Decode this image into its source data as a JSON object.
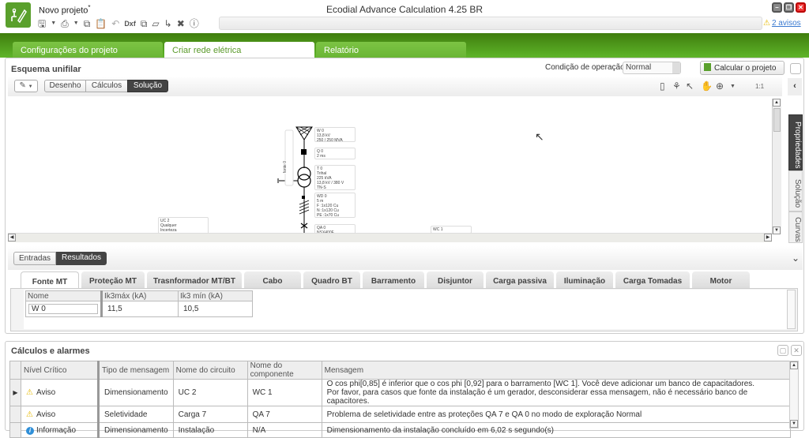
{
  "app": {
    "project_name": "Novo projeto",
    "unsaved_marker": "*",
    "window_title": "Ecodial Advance Calculation 4.25 BR",
    "warnings_link": "2 avisos",
    "quick_access": [
      "save-icon",
      "dropdown",
      "print-icon",
      "dropdown",
      "copy-icon",
      "paste-icon",
      "undo-icon",
      "Dxf",
      "attach-icon",
      "shape-icon",
      "export-icon",
      "tools-icon",
      "help-icon"
    ]
  },
  "main_tabs": [
    {
      "label": "Configurações do projeto",
      "active": false
    },
    {
      "label": "Criar rede elétrica",
      "active": true
    },
    {
      "label": "Relatório",
      "active": false
    }
  ],
  "esquema": {
    "title": "Esquema unifilar",
    "operating_condition_label": "Condição de operação",
    "operating_condition_value": "Normal",
    "calculate_button": "Calcular o projeto",
    "modes": [
      {
        "label": "Desenho",
        "active": false
      },
      {
        "label": "Cálculos",
        "active": false
      },
      {
        "label": "Solução",
        "active": true
      }
    ],
    "zoom_label": "1:1",
    "side_tabs": [
      "Propriedades",
      "Solução",
      "Curvas"
    ],
    "diagram": {
      "vertical_label": "fonte 0",
      "blocks": [
        {
          "lines": [
            "W 0",
            "13,8 kV",
            "250 / 250 MVA"
          ]
        },
        {
          "lines": [
            "Q 0",
            "2 ms"
          ]
        },
        {
          "lines": [
            "T 0",
            "Trihal",
            "225 kVA",
            "13,8 kV / 380 V",
            "TN-S"
          ]
        },
        {
          "lines": [
            "WD 0",
            "5 m",
            "F :1x120 Cu",
            "N :1x120 Cu",
            "PE :1x70 Cu"
          ]
        },
        {
          "lines": [
            "QA 0",
            "NSX400F"
          ]
        },
        {
          "lines": [
            "UC 2",
            "Qualquer",
            "Incerteza"
          ]
        },
        {
          "lines": [
            "WC 1"
          ]
        }
      ]
    }
  },
  "results": {
    "toggle": [
      {
        "label": "Entradas",
        "active": false
      },
      {
        "label": "Resultados",
        "active": true
      }
    ],
    "tabs": [
      "Fonte MT",
      "Proteção MT",
      "Trasnformador MT/BT",
      "Cabo",
      "Quadro BT",
      "Barramento",
      "Disjuntor",
      "Carga passiva",
      "Iluminação",
      "Carga Tomadas",
      "Motor"
    ],
    "active_tab": "Fonte MT",
    "columns": [
      "Nome",
      "Ik3máx (kA)",
      "Ik3 mín (kA)"
    ],
    "rows": [
      {
        "name": "W 0",
        "ik3max": "11,5",
        "ik3min": "10,5"
      }
    ]
  },
  "alarms": {
    "title": "Cálculos e alarmes",
    "columns": [
      "Nível Crítico",
      "Tipo de mensagem",
      "Nome do circuito",
      "Nome do componente",
      "Mensagem"
    ],
    "rows": [
      {
        "level": "Aviso",
        "level_icon": "warning-icon",
        "type": "Dimensionamento",
        "circuit": "UC 2",
        "component": "WC 1",
        "message_1": "O cos phi[0,85] é inferior que o cos phi [0,92] para o barramento [WC 1]. Você deve adicionar um banco de capacitadores.",
        "message_2": "Por favor, para casos que fonte da instalação é um gerador, desconsiderar essa mensagem, não é necessário banco de capacitores."
      },
      {
        "level": "Aviso",
        "level_icon": "warning-icon",
        "type": "Seletividade",
        "circuit": "Carga 7",
        "component": "QA 7",
        "message_1": "Problema de seletividade entre as proteções QA 7 e QA 0 no modo de exploração Normal",
        "message_2": ""
      },
      {
        "level": "Informação",
        "level_icon": "info-icon",
        "type": "Dimensionamento",
        "circuit": "Instalação",
        "component": "N/A",
        "message_1": "Dimensionamento da instalação concluído em 6,02 s segundo(s)",
        "message_2": ""
      }
    ]
  },
  "colors": {
    "brand_green": "#5aa02c",
    "ribbon_dark": "#3f7d0d",
    "active_segment": "#444444",
    "warning": "#e6b800",
    "info": "#2f8fd8",
    "link": "#3a7ad0"
  }
}
